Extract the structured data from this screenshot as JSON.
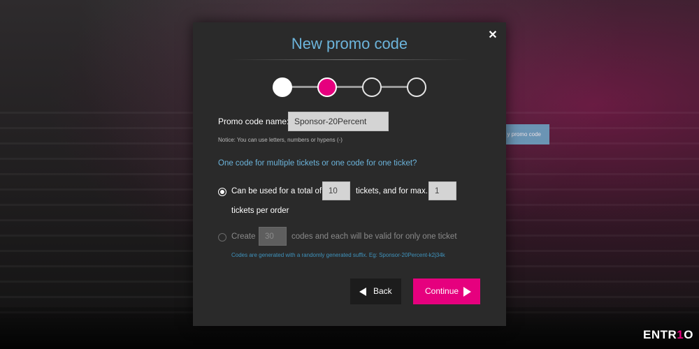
{
  "modal": {
    "title": "New promo code",
    "close_icon": "close-icon",
    "steps": {
      "total": 4,
      "current": 2
    }
  },
  "form": {
    "name_label": "Promo code name:",
    "name_value": "Sponsor-20Percent",
    "notice": "Notice: You can use letters, numbers or hypens (-)",
    "question": "One code for multiple tickets or one code for one ticket?",
    "option1": {
      "selected": true,
      "text_before": "Can be used for a total of",
      "total_value": "10",
      "text_middle": "tickets, and for max.",
      "max_value": "1",
      "text_after": "tickets per order"
    },
    "option2": {
      "selected": false,
      "text_before": "Create",
      "codes_value": "30",
      "text_after": "codes and each will be valid for only one ticket",
      "note": "Codes are generated with a randomly generated suffix. Eg: Sponsor-20Percent-k2j34k"
    }
  },
  "buttons": {
    "back_label": "Back",
    "continue_label": "Continue"
  },
  "background": {
    "button_label": "y promo code"
  },
  "logo": {
    "part1": "ENTR",
    "part2": "1",
    "part3": "O"
  },
  "colors": {
    "accent": "#e6007e",
    "title": "#6cb4db",
    "modal_bg": "#2a2a2a"
  }
}
